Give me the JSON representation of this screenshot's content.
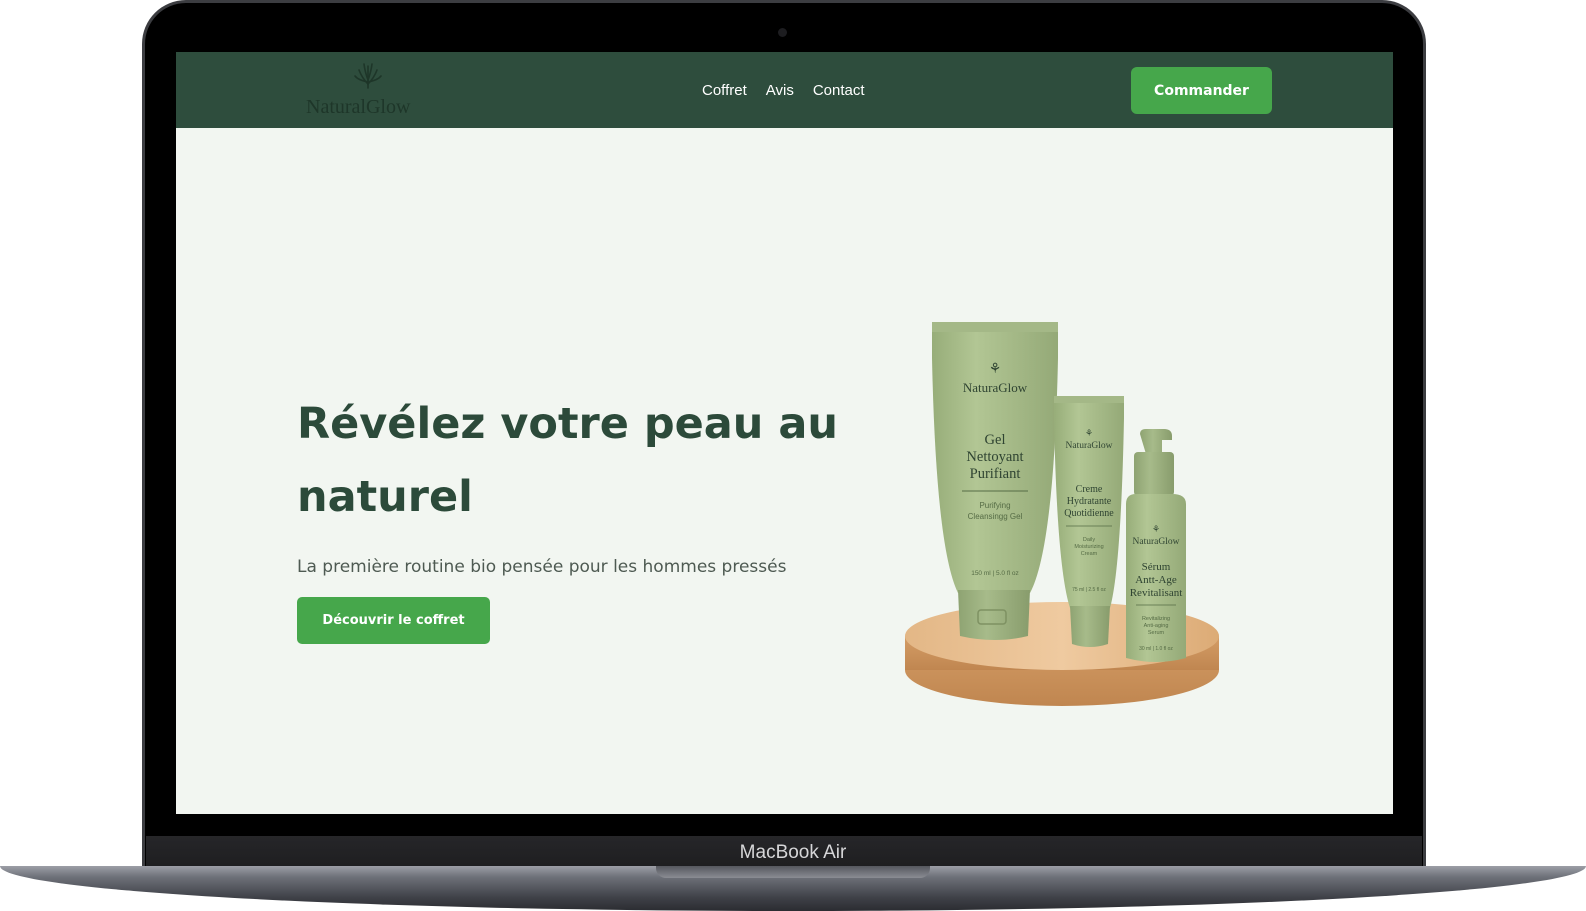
{
  "device": {
    "model_label": "MacBook Air"
  },
  "nav": {
    "brand": "NaturalGlow",
    "links": [
      "Coffret",
      "Avis",
      "Contact"
    ],
    "cta_label": "Commander"
  },
  "hero": {
    "title": "Révélez votre peau au naturel",
    "subtitle": "La première routine bio pensée pour les hommes pressés",
    "cta_label": "Découvrir le coffret"
  },
  "products": {
    "tube_large": {
      "brand": "NaturaGlow",
      "name_lines": [
        "Gel",
        "Nettoyant",
        "Purifiant"
      ],
      "sub_lines": [
        "Purifying",
        "Cleansingg Gel"
      ],
      "volume": "150 ml | 5.0 fl oz"
    },
    "tube_small": {
      "brand": "NaturaGlow",
      "name_lines": [
        "Creme",
        "Hydratante",
        "Quotidienne"
      ],
      "sub_lines": [
        "Daily",
        "Moisturizing",
        "Cream"
      ],
      "volume": "75 ml | 2.5 fl oz"
    },
    "pump_bottle": {
      "brand": "NaturaGlow",
      "name_lines": [
        "Sérum",
        "Antt-Age",
        "Revitalisant"
      ],
      "sub_lines": [
        "Revitalizing",
        "Anti-aging",
        "Serum"
      ],
      "volume": "30 ml | 1.0 fl oz"
    }
  },
  "colors": {
    "nav_bg": "#2e4d3d",
    "accent_green": "#46a74b",
    "title_green": "#2c4a3a",
    "page_bg": "#f2f6f1",
    "product_sage": "#a8bd8a"
  }
}
